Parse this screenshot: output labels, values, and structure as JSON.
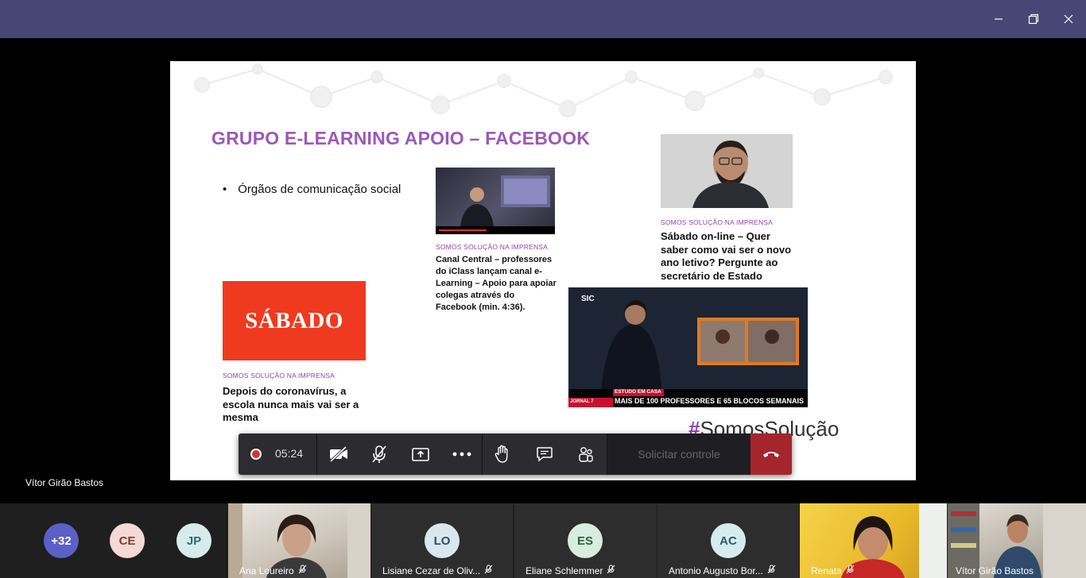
{
  "window": {
    "controls": [
      "minimize-icon",
      "restore-icon",
      "close-icon"
    ]
  },
  "slide": {
    "title": "GRUPO E-LEARNING APOIO – FACEBOOK",
    "bullet": "Órgãos de comunicação social",
    "kicker": "SOMOS SOLUÇÃO NA IMPRENSA",
    "article_canal": "Canal Central – professores do iClass lançam canal e-Learning – Apoio para apoiar colegas através do Facebook (min. 4:36).",
    "article_sabado_online": "Sábado on-line – Quer saber como vai ser o novo ano letivo? Pergunte ao secretário de Estado",
    "sabado_logo": "SÁBADO",
    "article_sabado": "Depois do coronavírus, a escola nunca mais vai ser a mesma",
    "sic_tag": "SIC",
    "sic_banner_small": "ESTUDO EM CASA",
    "sic_banner": "MAIS DE 100 PROFESSORES E 65 BLOCOS SEMANAIS",
    "sic_program": "JORNAL 7",
    "hashtag_hash": "#",
    "hashtag_text": "SomosSolução"
  },
  "controls": {
    "timer": "05:24",
    "request_control": "Solicitar controle",
    "record_color": "#d13438",
    "hangup_color": "#a4262c"
  },
  "presenter": {
    "name": "Vítor Girão Bastos"
  },
  "participants": {
    "overflow": {
      "label": "+32",
      "color": "#5b5fc7"
    },
    "ce": {
      "initials": "CE",
      "color": "#f4d9d6",
      "text_color": "#7a3a3a"
    },
    "jp": {
      "initials": "JP",
      "color": "#d6ecec",
      "text_color": "#2f6b6b"
    },
    "ana": {
      "name": "Ana Loureiro"
    },
    "lisiane": {
      "initials": "LO",
      "name": "Lisiane Cezar de Oliv...",
      "color": "#d9e7ef",
      "text_color": "#2c4e63"
    },
    "eliane": {
      "initials": "ES",
      "name": "Eliane Schlemmer",
      "color": "#d8ecdf",
      "text_color": "#2f5e41"
    },
    "antonio": {
      "initials": "AC",
      "name": "Antonio Augusto Bor...",
      "color": "#d6ebee",
      "text_color": "#2c5a61"
    },
    "renata": {
      "name": "Renata"
    },
    "vitor": {
      "name": "Vítor Girão Bastos"
    }
  }
}
